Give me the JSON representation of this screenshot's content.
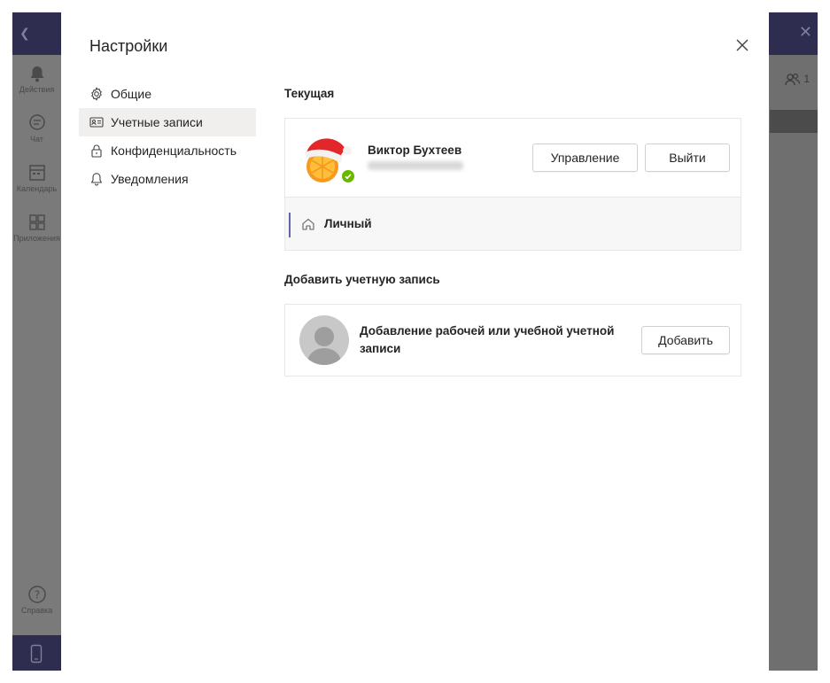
{
  "dialog": {
    "title": "Настройки",
    "close_icon": "close-icon"
  },
  "nav": {
    "items": [
      {
        "label": "Общие",
        "icon": "gear-icon",
        "active": false
      },
      {
        "label": "Учетные записи",
        "icon": "id-card-icon",
        "active": true
      },
      {
        "label": "Конфиденциальность",
        "icon": "lock-icon",
        "active": false
      },
      {
        "label": "Уведомления",
        "icon": "bell-icon",
        "active": false
      }
    ]
  },
  "current": {
    "section_title": "Текущая",
    "user_name": "Виктор Бухтеев",
    "manage_label": "Управление",
    "signout_label": "Выйти",
    "profile_label": "Личный",
    "status": "available"
  },
  "add_account": {
    "section_title": "Добавить учетную запись",
    "description": "Добавление рабочей или учебной учетной записи",
    "add_label": "Добавить"
  },
  "background_app": {
    "rail": [
      {
        "label": "Действия",
        "icon": "bell-icon"
      },
      {
        "label": "Чат",
        "icon": "chat-icon"
      },
      {
        "label": "Календарь",
        "icon": "calendar-icon"
      },
      {
        "label": "Приложения",
        "icon": "apps-icon"
      },
      {
        "label": "Справка",
        "icon": "help-icon"
      }
    ],
    "participants_count": "1"
  },
  "colors": {
    "accent": "#6264a7",
    "status_available": "#6bb700",
    "app_header": "#2e2d4f"
  }
}
